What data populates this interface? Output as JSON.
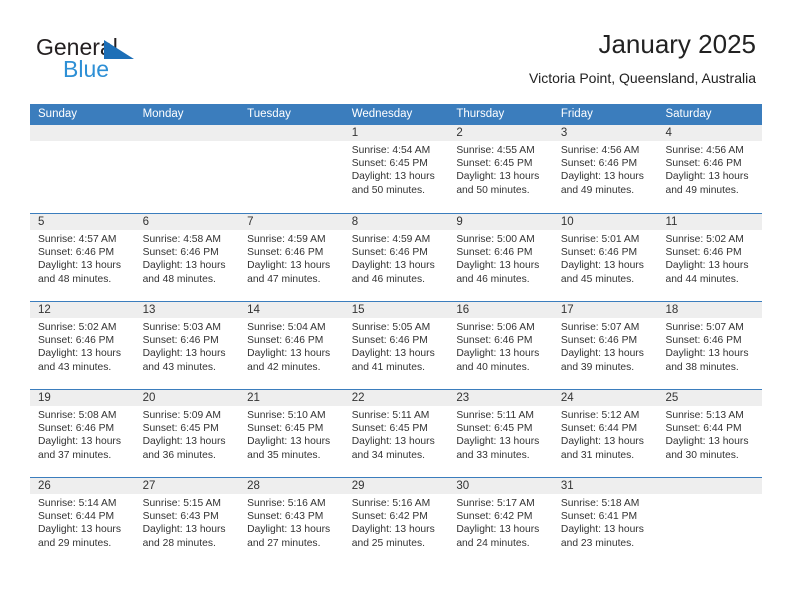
{
  "logo": {
    "word1": "General",
    "word2": "Blue",
    "triangle_color": "#1d6fb7",
    "blue_color": "#2d8fd5"
  },
  "header": {
    "title": "January 2025",
    "subtitle": "Victoria Point, Queensland, Australia"
  },
  "theme": {
    "header_blue": "#3b7dbd",
    "day_band_gray": "#eeeeee",
    "text": "#333333"
  },
  "weekdays": [
    "Sunday",
    "Monday",
    "Tuesday",
    "Wednesday",
    "Thursday",
    "Friday",
    "Saturday"
  ],
  "weeks": [
    [
      {
        "day": "",
        "sunrise": "",
        "sunset": "",
        "daylight_line1": "",
        "daylight_line2": ""
      },
      {
        "day": "",
        "sunrise": "",
        "sunset": "",
        "daylight_line1": "",
        "daylight_line2": ""
      },
      {
        "day": "",
        "sunrise": "",
        "sunset": "",
        "daylight_line1": "",
        "daylight_line2": ""
      },
      {
        "day": "1",
        "sunrise": "Sunrise: 4:54 AM",
        "sunset": "Sunset: 6:45 PM",
        "daylight_line1": "Daylight: 13 hours",
        "daylight_line2": "and 50 minutes."
      },
      {
        "day": "2",
        "sunrise": "Sunrise: 4:55 AM",
        "sunset": "Sunset: 6:45 PM",
        "daylight_line1": "Daylight: 13 hours",
        "daylight_line2": "and 50 minutes."
      },
      {
        "day": "3",
        "sunrise": "Sunrise: 4:56 AM",
        "sunset": "Sunset: 6:46 PM",
        "daylight_line1": "Daylight: 13 hours",
        "daylight_line2": "and 49 minutes."
      },
      {
        "day": "4",
        "sunrise": "Sunrise: 4:56 AM",
        "sunset": "Sunset: 6:46 PM",
        "daylight_line1": "Daylight: 13 hours",
        "daylight_line2": "and 49 minutes."
      }
    ],
    [
      {
        "day": "5",
        "sunrise": "Sunrise: 4:57 AM",
        "sunset": "Sunset: 6:46 PM",
        "daylight_line1": "Daylight: 13 hours",
        "daylight_line2": "and 48 minutes."
      },
      {
        "day": "6",
        "sunrise": "Sunrise: 4:58 AM",
        "sunset": "Sunset: 6:46 PM",
        "daylight_line1": "Daylight: 13 hours",
        "daylight_line2": "and 48 minutes."
      },
      {
        "day": "7",
        "sunrise": "Sunrise: 4:59 AM",
        "sunset": "Sunset: 6:46 PM",
        "daylight_line1": "Daylight: 13 hours",
        "daylight_line2": "and 47 minutes."
      },
      {
        "day": "8",
        "sunrise": "Sunrise: 4:59 AM",
        "sunset": "Sunset: 6:46 PM",
        "daylight_line1": "Daylight: 13 hours",
        "daylight_line2": "and 46 minutes."
      },
      {
        "day": "9",
        "sunrise": "Sunrise: 5:00 AM",
        "sunset": "Sunset: 6:46 PM",
        "daylight_line1": "Daylight: 13 hours",
        "daylight_line2": "and 46 minutes."
      },
      {
        "day": "10",
        "sunrise": "Sunrise: 5:01 AM",
        "sunset": "Sunset: 6:46 PM",
        "daylight_line1": "Daylight: 13 hours",
        "daylight_line2": "and 45 minutes."
      },
      {
        "day": "11",
        "sunrise": "Sunrise: 5:02 AM",
        "sunset": "Sunset: 6:46 PM",
        "daylight_line1": "Daylight: 13 hours",
        "daylight_line2": "and 44 minutes."
      }
    ],
    [
      {
        "day": "12",
        "sunrise": "Sunrise: 5:02 AM",
        "sunset": "Sunset: 6:46 PM",
        "daylight_line1": "Daylight: 13 hours",
        "daylight_line2": "and 43 minutes."
      },
      {
        "day": "13",
        "sunrise": "Sunrise: 5:03 AM",
        "sunset": "Sunset: 6:46 PM",
        "daylight_line1": "Daylight: 13 hours",
        "daylight_line2": "and 43 minutes."
      },
      {
        "day": "14",
        "sunrise": "Sunrise: 5:04 AM",
        "sunset": "Sunset: 6:46 PM",
        "daylight_line1": "Daylight: 13 hours",
        "daylight_line2": "and 42 minutes."
      },
      {
        "day": "15",
        "sunrise": "Sunrise: 5:05 AM",
        "sunset": "Sunset: 6:46 PM",
        "daylight_line1": "Daylight: 13 hours",
        "daylight_line2": "and 41 minutes."
      },
      {
        "day": "16",
        "sunrise": "Sunrise: 5:06 AM",
        "sunset": "Sunset: 6:46 PM",
        "daylight_line1": "Daylight: 13 hours",
        "daylight_line2": "and 40 minutes."
      },
      {
        "day": "17",
        "sunrise": "Sunrise: 5:07 AM",
        "sunset": "Sunset: 6:46 PM",
        "daylight_line1": "Daylight: 13 hours",
        "daylight_line2": "and 39 minutes."
      },
      {
        "day": "18",
        "sunrise": "Sunrise: 5:07 AM",
        "sunset": "Sunset: 6:46 PM",
        "daylight_line1": "Daylight: 13 hours",
        "daylight_line2": "and 38 minutes."
      }
    ],
    [
      {
        "day": "19",
        "sunrise": "Sunrise: 5:08 AM",
        "sunset": "Sunset: 6:46 PM",
        "daylight_line1": "Daylight: 13 hours",
        "daylight_line2": "and 37 minutes."
      },
      {
        "day": "20",
        "sunrise": "Sunrise: 5:09 AM",
        "sunset": "Sunset: 6:45 PM",
        "daylight_line1": "Daylight: 13 hours",
        "daylight_line2": "and 36 minutes."
      },
      {
        "day": "21",
        "sunrise": "Sunrise: 5:10 AM",
        "sunset": "Sunset: 6:45 PM",
        "daylight_line1": "Daylight: 13 hours",
        "daylight_line2": "and 35 minutes."
      },
      {
        "day": "22",
        "sunrise": "Sunrise: 5:11 AM",
        "sunset": "Sunset: 6:45 PM",
        "daylight_line1": "Daylight: 13 hours",
        "daylight_line2": "and 34 minutes."
      },
      {
        "day": "23",
        "sunrise": "Sunrise: 5:11 AM",
        "sunset": "Sunset: 6:45 PM",
        "daylight_line1": "Daylight: 13 hours",
        "daylight_line2": "and 33 minutes."
      },
      {
        "day": "24",
        "sunrise": "Sunrise: 5:12 AM",
        "sunset": "Sunset: 6:44 PM",
        "daylight_line1": "Daylight: 13 hours",
        "daylight_line2": "and 31 minutes."
      },
      {
        "day": "25",
        "sunrise": "Sunrise: 5:13 AM",
        "sunset": "Sunset: 6:44 PM",
        "daylight_line1": "Daylight: 13 hours",
        "daylight_line2": "and 30 minutes."
      }
    ],
    [
      {
        "day": "26",
        "sunrise": "Sunrise: 5:14 AM",
        "sunset": "Sunset: 6:44 PM",
        "daylight_line1": "Daylight: 13 hours",
        "daylight_line2": "and 29 minutes."
      },
      {
        "day": "27",
        "sunrise": "Sunrise: 5:15 AM",
        "sunset": "Sunset: 6:43 PM",
        "daylight_line1": "Daylight: 13 hours",
        "daylight_line2": "and 28 minutes."
      },
      {
        "day": "28",
        "sunrise": "Sunrise: 5:16 AM",
        "sunset": "Sunset: 6:43 PM",
        "daylight_line1": "Daylight: 13 hours",
        "daylight_line2": "and 27 minutes."
      },
      {
        "day": "29",
        "sunrise": "Sunrise: 5:16 AM",
        "sunset": "Sunset: 6:42 PM",
        "daylight_line1": "Daylight: 13 hours",
        "daylight_line2": "and 25 minutes."
      },
      {
        "day": "30",
        "sunrise": "Sunrise: 5:17 AM",
        "sunset": "Sunset: 6:42 PM",
        "daylight_line1": "Daylight: 13 hours",
        "daylight_line2": "and 24 minutes."
      },
      {
        "day": "31",
        "sunrise": "Sunrise: 5:18 AM",
        "sunset": "Sunset: 6:41 PM",
        "daylight_line1": "Daylight: 13 hours",
        "daylight_line2": "and 23 minutes."
      },
      {
        "day": "",
        "sunrise": "",
        "sunset": "",
        "daylight_line1": "",
        "daylight_line2": ""
      }
    ]
  ]
}
